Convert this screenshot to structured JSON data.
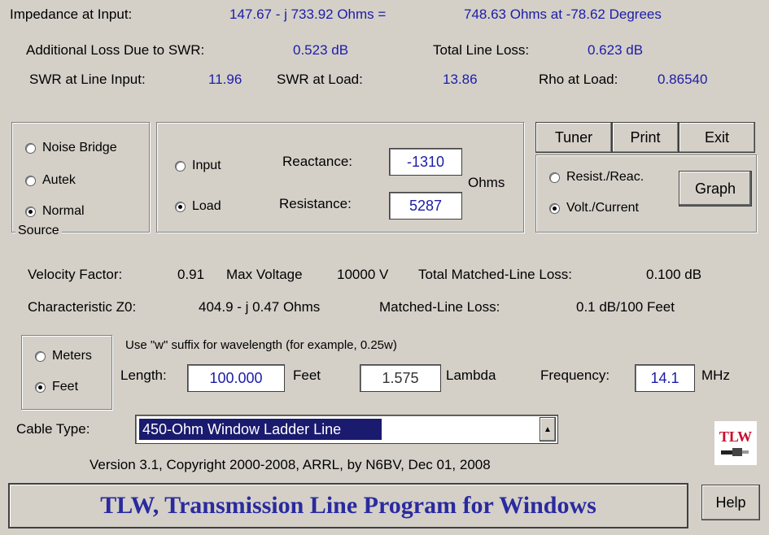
{
  "impedance": {
    "label": "Impedance at Input:",
    "value": "147.67 - j 733.92  Ohms  =",
    "magnitude": "748.63 Ohms at  -78.62 Degrees"
  },
  "loss": {
    "additional_label": "Additional Loss Due to SWR:",
    "additional_value": "0.523  dB",
    "total_label": "Total Line Loss:",
    "total_value": "0.623 dB"
  },
  "swr": {
    "input_label": "SWR at Line Input:",
    "input_value": "11.96",
    "load_label": "SWR at Load:",
    "load_value": "13.86",
    "rho_label": "Rho at Load:",
    "rho_value": "0.86540"
  },
  "source": {
    "legend": "Source",
    "options": [
      "Noise Bridge",
      "Autek",
      "Normal"
    ],
    "selected": "Normal"
  },
  "impedance_input": {
    "options": [
      "Input",
      "Load"
    ],
    "selected": "Load",
    "reactance_label": "Reactance:",
    "reactance_value": "-1310",
    "resistance_label": "Resistance:",
    "resistance_value": "5287",
    "units": "Ohms"
  },
  "actions": {
    "tuner": "Tuner",
    "print": "Print",
    "exit": "Exit",
    "graph": "Graph",
    "help": "Help"
  },
  "graph_mode": {
    "options": [
      "Resist./Reac.",
      "Volt./Current"
    ],
    "selected": "Volt./Current"
  },
  "line_props": {
    "velocity_label": "Velocity Factor:",
    "velocity_value": "0.91",
    "max_voltage_label": "Max Voltage",
    "max_voltage_value": "10000 V",
    "matched_total_label": "Total Matched-Line Loss:",
    "matched_total_value": "0.100 dB",
    "z0_label": "Characteristic Z0:",
    "z0_value": "404.9 - j 0.47 Ohms",
    "matched_label": "Matched-Line Loss:",
    "matched_value": "0.1 dB/100 Feet"
  },
  "length": {
    "units": [
      "Meters",
      "Feet"
    ],
    "selected": "Feet",
    "hint": "Use \"w\" suffix for wavelength (for example, 0.25w)",
    "label": "Length:",
    "value": "100.000",
    "unit_label": "Feet",
    "lambda_value": "1.575",
    "lambda_label": "Lambda",
    "freq_label": "Frequency:",
    "freq_value": "14.1",
    "freq_unit": "MHz"
  },
  "cable": {
    "label": "Cable Type:",
    "selected": "450-Ohm Window Ladder Line"
  },
  "version": "Version 3.1, Copyright 2000-2008, ARRL, by N6BV, Dec 01, 2008",
  "banner": "TLW, Transmission Line Program for Windows",
  "logo": {
    "text": "TLW",
    "icon": "cable-plug-icon"
  }
}
